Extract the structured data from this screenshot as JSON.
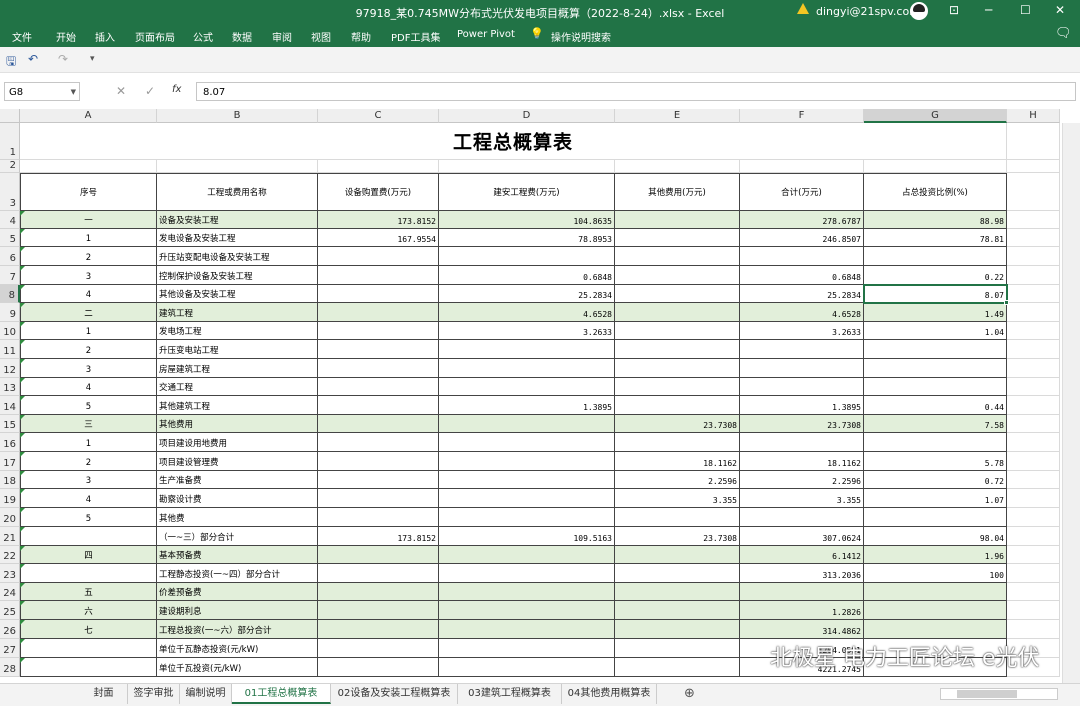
{
  "window": {
    "title": "97918_某0.745MW分布式光伏发电项目概算（2022-8-24）.xlsx  -  Excel",
    "user": "dingyi@21spv.com",
    "min": "─",
    "restore": "☐",
    "close": "✕",
    "ribbon_display": "⊡"
  },
  "menu": {
    "items": [
      "文件",
      "开始",
      "插入",
      "页面布局",
      "公式",
      "数据",
      "审阅",
      "视图",
      "帮助",
      "PDF工具集",
      "Power Pivot",
      "操作说明搜索"
    ],
    "comment_icon": "🗨"
  },
  "qat": {
    "save": "🖫",
    "undo": "↶",
    "redo": "↷",
    "more": "▾"
  },
  "formula_bar": {
    "name_box": "G8",
    "value": "8.07",
    "fx": "fx",
    "cancel": "✕",
    "enter": "✓"
  },
  "columns": [
    "A",
    "B",
    "C",
    "D",
    "E",
    "F",
    "G",
    "H"
  ],
  "rows_numbers": [
    "1",
    "2",
    "3",
    "4",
    "5",
    "6",
    "7",
    "8",
    "9",
    "10",
    "11",
    "12",
    "13",
    "14",
    "15",
    "16",
    "17",
    "18",
    "19",
    "20",
    "21",
    "22",
    "23",
    "24",
    "25",
    "26",
    "27",
    "28"
  ],
  "sheet": {
    "title": "工程总概算表",
    "headers": [
      "序号",
      "工程或费用名称",
      "设备购置费(万元)",
      "建安工程费(万元)",
      "其他费用(万元)",
      "合计(万元)",
      "占总投资比例(%)"
    ],
    "rows": [
      {
        "a": "一",
        "b": "设备及安装工程",
        "c": "173.8152",
        "d": "104.8635",
        "e": "",
        "f": "278.6787",
        "g": "88.98",
        "green": true
      },
      {
        "a": "1",
        "b": "发电设备及安装工程",
        "c": "167.9554",
        "d": "78.8953",
        "e": "",
        "f": "246.8507",
        "g": "78.81",
        "green": false
      },
      {
        "a": "2",
        "b": "升压站变配电设备及安装工程",
        "c": "",
        "d": "",
        "e": "",
        "f": "",
        "g": "",
        "green": false
      },
      {
        "a": "3",
        "b": "控制保护设备及安装工程",
        "c": "",
        "d": "0.6848",
        "e": "",
        "f": "0.6848",
        "g": "0.22",
        "green": false
      },
      {
        "a": "4",
        "b": "其他设备及安装工程",
        "c": "",
        "d": "25.2834",
        "e": "",
        "f": "25.2834",
        "g": "8.07",
        "green": false
      },
      {
        "a": "二",
        "b": "建筑工程",
        "c": "",
        "d": "4.6528",
        "e": "",
        "f": "4.6528",
        "g": "1.49",
        "green": true
      },
      {
        "a": "1",
        "b": "发电场工程",
        "c": "",
        "d": "3.2633",
        "e": "",
        "f": "3.2633",
        "g": "1.04",
        "green": false
      },
      {
        "a": "2",
        "b": "升压变电站工程",
        "c": "",
        "d": "",
        "e": "",
        "f": "",
        "g": "",
        "green": false
      },
      {
        "a": "3",
        "b": "房屋建筑工程",
        "c": "",
        "d": "",
        "e": "",
        "f": "",
        "g": "",
        "green": false
      },
      {
        "a": "4",
        "b": "交通工程",
        "c": "",
        "d": "",
        "e": "",
        "f": "",
        "g": "",
        "green": false
      },
      {
        "a": "5",
        "b": "其他建筑工程",
        "c": "",
        "d": "1.3895",
        "e": "",
        "f": "1.3895",
        "g": "0.44",
        "green": false
      },
      {
        "a": "三",
        "b": "其他费用",
        "c": "",
        "d": "",
        "e": "23.7308",
        "f": "23.7308",
        "g": "7.58",
        "green": true
      },
      {
        "a": "1",
        "b": "项目建设用地费用",
        "c": "",
        "d": "",
        "e": "",
        "f": "",
        "g": "",
        "green": false
      },
      {
        "a": "2",
        "b": "项目建设管理费",
        "c": "",
        "d": "",
        "e": "18.1162",
        "f": "18.1162",
        "g": "5.78",
        "green": false
      },
      {
        "a": "3",
        "b": "生产准备费",
        "c": "",
        "d": "",
        "e": "2.2596",
        "f": "2.2596",
        "g": "0.72",
        "green": false
      },
      {
        "a": "4",
        "b": "勘察设计费",
        "c": "",
        "d": "",
        "e": "3.355",
        "f": "3.355",
        "g": "1.07",
        "green": false
      },
      {
        "a": "5",
        "b": "其他费",
        "c": "",
        "d": "",
        "e": "",
        "f": "",
        "g": "",
        "green": false
      },
      {
        "a": "",
        "b": "（一~三）部分合计",
        "c": "173.8152",
        "d": "109.5163",
        "e": "23.7308",
        "f": "307.0624",
        "g": "98.04",
        "green": false
      },
      {
        "a": "四",
        "b": "基本预备费",
        "c": "",
        "d": "",
        "e": "",
        "f": "6.1412",
        "g": "1.96",
        "green": true
      },
      {
        "a": "",
        "b": "工程静态投资(一~四）部分合计",
        "c": "",
        "d": "",
        "e": "",
        "f": "313.2036",
        "g": "100",
        "green": false
      },
      {
        "a": "五",
        "b": "价差预备费",
        "c": "",
        "d": "",
        "e": "",
        "f": "",
        "g": "",
        "green": true
      },
      {
        "a": "六",
        "b": "建设期利息",
        "c": "",
        "d": "",
        "e": "",
        "f": "1.2826",
        "g": "",
        "green": true
      },
      {
        "a": "七",
        "b": "工程总投资(一~六）部分合计",
        "c": "",
        "d": "",
        "e": "",
        "f": "314.4862",
        "g": "",
        "green": true
      },
      {
        "a": "",
        "b": "单位千瓦静态投资(元/kW)",
        "c": "",
        "d": "",
        "e": "",
        "f": "4204.0591",
        "g": "",
        "green": false
      },
      {
        "a": "",
        "b": "单位千瓦投资(元/kW)",
        "c": "",
        "d": "",
        "e": "",
        "f": "4221.2745",
        "g": "",
        "green": false
      }
    ]
  },
  "sheet_tabs": [
    "封面",
    "签字审批",
    "编制说明",
    "01工程总概算表",
    "02设备及安装工程概算表",
    "03建筑工程概算表",
    "04其他费用概算表"
  ],
  "active_tab": "01工程总概算表",
  "add_sheet": "⊕",
  "watermark": "北极星 电力工匠论坛 e光伏"
}
